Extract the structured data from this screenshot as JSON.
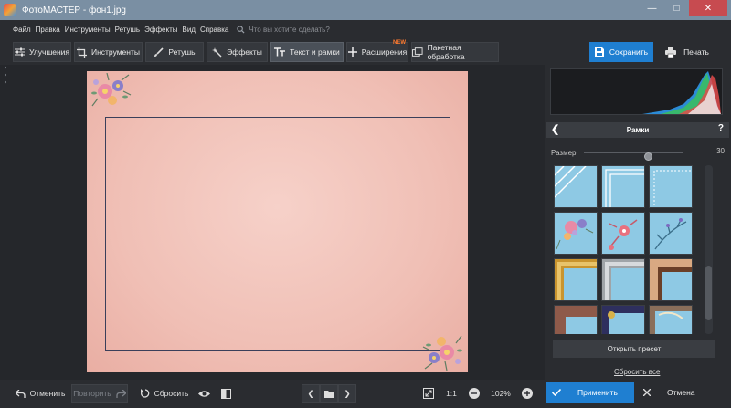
{
  "window": {
    "title": "ФотоМАСТЕР - фон1.jpg"
  },
  "menu": {
    "items": [
      "Файл",
      "Правка",
      "Инструменты",
      "Ретушь",
      "Эффекты",
      "Вид",
      "Справка"
    ],
    "search_placeholder": "Что вы хотите сделать?"
  },
  "toolbar": {
    "tabs": [
      {
        "label": "Улучшения",
        "icon": "sliders-icon"
      },
      {
        "label": "Инструменты",
        "icon": "crop-icon"
      },
      {
        "label": "Ретушь",
        "icon": "brush-icon"
      },
      {
        "label": "Эффекты",
        "icon": "magic-wand-icon"
      },
      {
        "label": "Текст и рамки",
        "icon": "text-icon",
        "active": true
      },
      {
        "label": "Расширения",
        "icon": "plus-icon",
        "badge": "NEW"
      },
      {
        "label": "Пакетная обработка",
        "icon": "batch-icon"
      }
    ],
    "save_label": "Сохранить",
    "print_label": "Печать",
    "accent_color": "#1f7fd1"
  },
  "panel": {
    "title": "Рамки",
    "help": "?",
    "size_label": "Размер",
    "size_value": "30",
    "size_fraction": 0.3,
    "open_preset_label": "Открыть пресет",
    "reset_all_label": "Сбросить все"
  },
  "bottom": {
    "undo_label": "Отменить",
    "redo_label": "Повторить",
    "reset_label": "Сбросить",
    "ratio_label": "1:1",
    "zoom_value": "102%",
    "apply_label": "Применить",
    "cancel_label": "Отмена"
  }
}
